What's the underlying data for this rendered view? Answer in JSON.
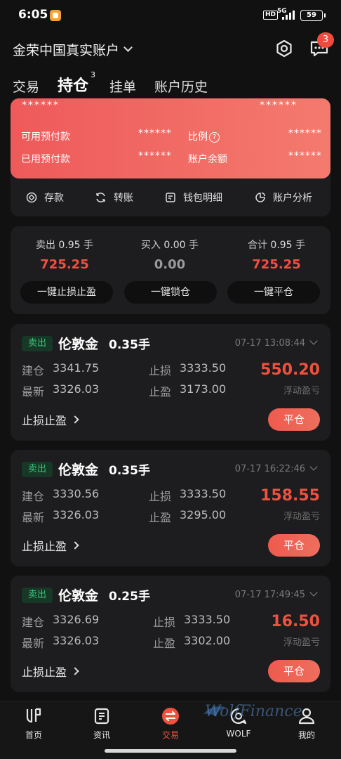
{
  "status_bar": {
    "time": "6:05",
    "hd": "HD",
    "network": "5G",
    "battery": "59"
  },
  "header": {
    "account_title": "金荣中国真实账户",
    "message_badge": "3"
  },
  "tabs": [
    {
      "label": "交易"
    },
    {
      "label": "持仓",
      "sup": "3"
    },
    {
      "label": "挂单"
    },
    {
      "label": "账户历史"
    }
  ],
  "funds": {
    "masked_top_left": "******",
    "masked_top_right": "******",
    "available_prepay_label": "可用预付款",
    "available_prepay_value": "******",
    "ratio_label": "比例",
    "ratio_value": "******",
    "used_prepay_label": "已用预付款",
    "used_prepay_value": "******",
    "balance_label": "账户余额",
    "balance_value": "******"
  },
  "actions": [
    {
      "label": "存款",
      "icon": "deposit-icon"
    },
    {
      "label": "转账",
      "icon": "transfer-icon"
    },
    {
      "label": "钱包明细",
      "icon": "wallet-detail-icon"
    },
    {
      "label": "账户分析",
      "icon": "analysis-icon"
    }
  ],
  "summary": {
    "sell_label": "卖出",
    "sell_lots": "0.95",
    "sell_unit": "手",
    "sell_value": "725.25",
    "buy_label": "买入",
    "buy_lots": "0.00",
    "buy_unit": "手",
    "buy_value": "0.00",
    "total_label": "合计",
    "total_lots": "0.95",
    "total_unit": "手",
    "total_value": "725.25",
    "btn_sltp": "一键止损止盈",
    "btn_lock": "一键锁仓",
    "btn_close_all": "一键平仓"
  },
  "positions": [
    {
      "side": "卖出",
      "symbol": "伦敦金",
      "lots": "0.35手",
      "time": "07-17 13:08:44",
      "open_label": "建仓",
      "open_price": "3341.75",
      "sl_label": "止损",
      "sl_price": "3333.50",
      "last_label": "最新",
      "last_price": "3326.03",
      "tp_label": "止盈",
      "tp_price": "3173.00",
      "pnl": "550.20",
      "pnl_label": "浮动盈亏",
      "sltp_link": "止损止盈",
      "close_btn": "平仓"
    },
    {
      "side": "卖出",
      "symbol": "伦敦金",
      "lots": "0.35手",
      "time": "07-17 16:22:46",
      "open_label": "建仓",
      "open_price": "3330.56",
      "sl_label": "止损",
      "sl_price": "3333.50",
      "last_label": "最新",
      "last_price": "3326.03",
      "tp_label": "止盈",
      "tp_price": "3295.00",
      "pnl": "158.55",
      "pnl_label": "浮动盈亏",
      "sltp_link": "止损止盈",
      "close_btn": "平仓"
    },
    {
      "side": "卖出",
      "symbol": "伦敦金",
      "lots": "0.25手",
      "time": "07-17 17:49:45",
      "open_label": "建仓",
      "open_price": "3326.69",
      "sl_label": "止损",
      "sl_price": "3333.50",
      "last_label": "最新",
      "last_price": "3326.03",
      "tp_label": "止盈",
      "tp_price": "3302.00",
      "pnl": "16.50",
      "pnl_label": "浮动盈亏",
      "sltp_link": "止损止盈",
      "close_btn": "平仓"
    }
  ],
  "bottom_nav": [
    {
      "label": "首页",
      "icon": "home-icon"
    },
    {
      "label": "资讯",
      "icon": "news-icon"
    },
    {
      "label": "交易",
      "icon": "trade-icon",
      "active": true
    },
    {
      "label": "WOLF",
      "icon": "wolf-icon"
    },
    {
      "label": "我的",
      "icon": "profile-icon"
    }
  ],
  "watermark": "WolfFinance",
  "colors": {
    "accent_red": "#f0513f",
    "sell_tag_green": "#39c57a",
    "card_bg": "#1d1d1f",
    "page_bg": "#111111"
  }
}
